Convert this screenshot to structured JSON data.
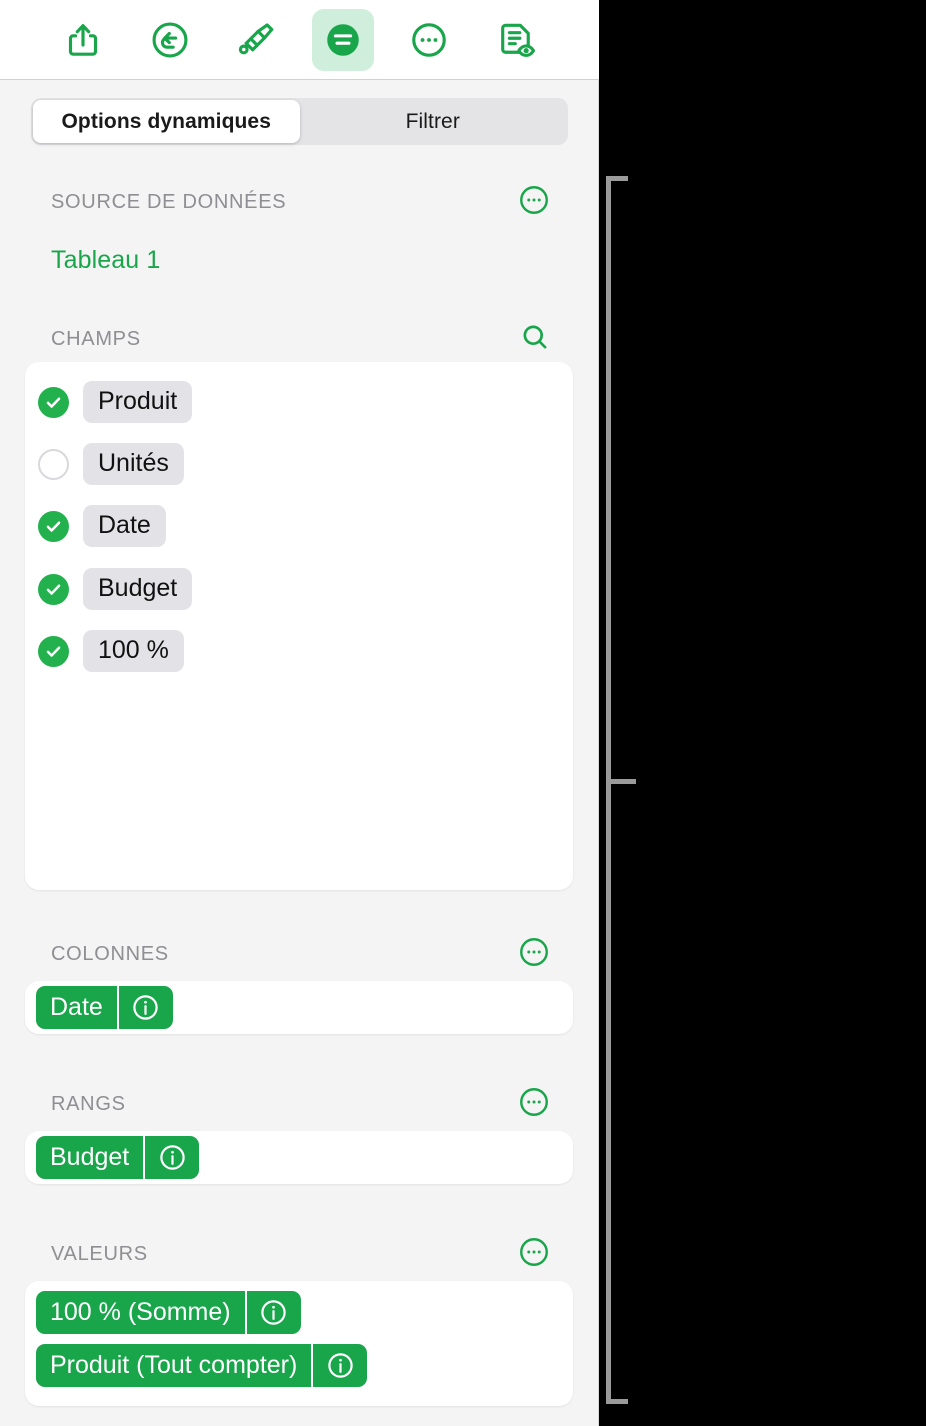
{
  "toolbar": {
    "buttons": [
      {
        "name": "share-icon",
        "label": "Partager",
        "active": false
      },
      {
        "name": "undo-icon",
        "label": "Annuler",
        "active": false
      },
      {
        "name": "paintbrush-icon",
        "label": "Format du pinceau",
        "active": false
      },
      {
        "name": "format-icon",
        "label": "Format",
        "active": true
      },
      {
        "name": "more-icon",
        "label": "Plus",
        "active": false
      },
      {
        "name": "document-preview-icon",
        "label": "Aperçu du document",
        "active": false
      }
    ]
  },
  "tabs": [
    {
      "label": "Options dynamiques",
      "selected": true
    },
    {
      "label": "Filtrer",
      "selected": false
    }
  ],
  "sections": {
    "data_source": {
      "title": "SOURCE DE DONNÉES",
      "value": "Tableau 1",
      "more_icon": "more-circle-icon"
    },
    "fields": {
      "title": "CHAMPS",
      "search_icon": "search-icon",
      "items": [
        {
          "label": "Produit",
          "checked": true
        },
        {
          "label": "Unités",
          "checked": false
        },
        {
          "label": "Date",
          "checked": true
        },
        {
          "label": "Budget",
          "checked": true
        },
        {
          "label": "100 %",
          "checked": true
        }
      ]
    },
    "columns": {
      "title": "COLONNES",
      "more_icon": "more-circle-icon",
      "items": [
        {
          "label": "Date",
          "info_icon": "info-circle-icon"
        }
      ]
    },
    "rows": {
      "title": "RANGS",
      "more_icon": "more-circle-icon",
      "items": [
        {
          "label": "Budget",
          "info_icon": "info-circle-icon"
        }
      ]
    },
    "values": {
      "title": "VALEURS",
      "more_icon": "more-circle-icon",
      "items": [
        {
          "label": "100 % (Somme)",
          "info_icon": "info-circle-icon"
        },
        {
          "label": "Produit (Tout compter)",
          "info_icon": "info-circle-icon"
        }
      ]
    }
  },
  "colors": {
    "accent_green": "#19A64B",
    "check_green": "#22B14C",
    "active_tool_bg": "#CFEEDB",
    "panel_bg": "#F4F4F4",
    "chip_bg": "#E3E2E7",
    "label_gray": "#8E8E93",
    "callout_gray": "#9A9A9A"
  }
}
